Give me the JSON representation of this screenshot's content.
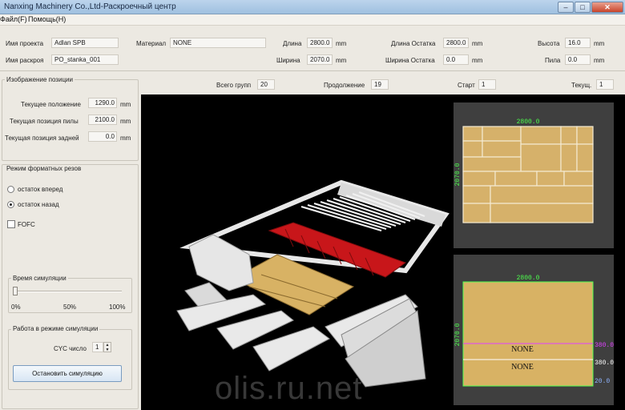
{
  "window": {
    "title": "Nanxing Machinery Co.,Ltd-Раскроечный центр",
    "min_glyph": "–",
    "max_glyph": "□",
    "close_glyph": "✕"
  },
  "menu": {
    "file": "Файл(F)",
    "help": "Помощь(H)"
  },
  "params": {
    "project_label": "Имя проекта",
    "project_value": "Adlan SPB",
    "cutting_label": "Имя раскроя",
    "cutting_value": "PO_stanka_001",
    "material_label": "Материал",
    "material_value": "NONE",
    "length_label": "Длина",
    "length_value": "2800.0",
    "width_label": "Ширина",
    "width_value": "2070.0",
    "rem_length_label": "Длина Остатка",
    "rem_length_value": "2800.0",
    "rem_width_label": "Ширина Остатка",
    "rem_width_value": "0.0",
    "height_label": "Высота",
    "height_value": "16.0",
    "saw_label": "Пила",
    "saw_value": "0.0",
    "unit": "mm"
  },
  "position": {
    "group_title": "Изображение позиции",
    "current_label": "Текущее положение",
    "current_value": "1290.0",
    "saw_pos_label": "Текущая позиция пилы",
    "saw_pos_value": "2100.0",
    "rear_pos_label": "Текущая позиция задней",
    "rear_pos_value": "0.0",
    "unit": "mm"
  },
  "mode": {
    "group_title": "Режим форматных резов",
    "forward_label": "остаток вперед",
    "backward_label": "остаток назад",
    "selected": "backward",
    "fofc_label": "FOFC",
    "fofc_checked": false
  },
  "simulation": {
    "time_title": "Время симуляции",
    "tick_0": "0%",
    "tick_50": "50%",
    "tick_100": "100%",
    "slider_level": 0,
    "work_title": "Работа в режиме симуляции",
    "cyc_label": "CYC число",
    "cyc_value": "1",
    "stop_button": "Остановить симуляцию"
  },
  "groupbar": {
    "total_label": "Всего групп",
    "total_value": "20",
    "cont_label": "Продолжение",
    "cont_value": "19",
    "start_label": "Старт",
    "start_value": "1",
    "current_label": "Текущ.",
    "current_value": "1"
  },
  "preview_top": {
    "width_dim": "2800.0",
    "height_dim": "2070.0"
  },
  "preview_bottom": {
    "width_dim": "2800.0",
    "height_dim": "2070.0",
    "strip1_label": "NONE",
    "strip2_label": "NONE",
    "dim_a": "380.0",
    "dim_b": "380.0",
    "dim_c": "20.0"
  },
  "colors": {
    "board": "#d8b264",
    "outline": "#4dff4d",
    "saw_red": "#c8161a",
    "dim_magenta": "#e040ff",
    "dim_white": "#ffffff"
  },
  "watermark": "olis.ru.net"
}
